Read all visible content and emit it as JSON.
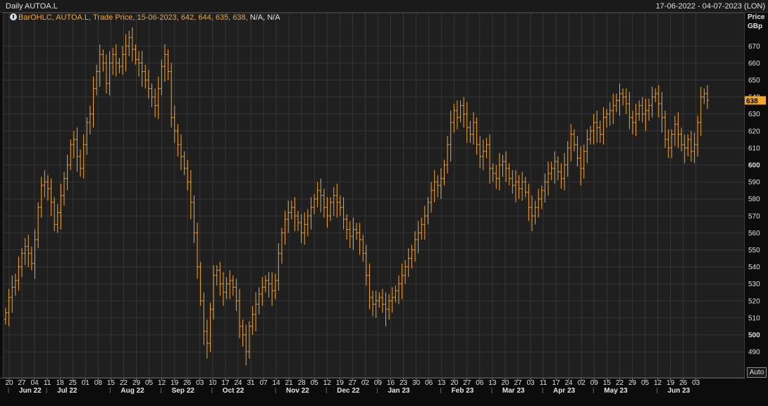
{
  "header": {
    "title": "Daily AUTOA.L",
    "date_range": "17-06-2022 - 04-07-2023 (LON)"
  },
  "legend": {
    "text": "BarOHLC, AUTOA.L, Trade Price,  15-06-2023, 642, 644, 635, 638,",
    "na": " N/A, N/A",
    "icon": "info-circle-icon"
  },
  "y_axis": {
    "title_line1": "Price",
    "title_line2": "GBp",
    "ticks": [
      490,
      500,
      510,
      520,
      530,
      540,
      550,
      560,
      570,
      580,
      590,
      600,
      610,
      620,
      630,
      640,
      650,
      660,
      670
    ],
    "bold_ticks": [
      500,
      600
    ],
    "last_value": "638"
  },
  "x_axis": {
    "day_ticks": [
      "20",
      "27",
      "04",
      "11",
      "18",
      "25",
      "01",
      "08",
      "15",
      "22",
      "29",
      "05",
      "12",
      "19",
      "26",
      "03",
      "10",
      "17",
      "24",
      "31",
      "07",
      "14",
      "21",
      "28",
      "05",
      "12",
      "19",
      "27",
      "02",
      "09",
      "16",
      "23",
      "30",
      "06",
      "13",
      "20",
      "27",
      "06",
      "13",
      "20",
      "27",
      "03",
      "11",
      "17",
      "24",
      "02",
      "09",
      "15",
      "22",
      "29",
      "05",
      "12",
      "19",
      "26",
      "03"
    ],
    "month_labels": [
      {
        "label": "Jun 22",
        "tick": 0
      },
      {
        "label": "Jul 22",
        "tick": 3
      },
      {
        "label": "Aug 22",
        "tick": 8
      },
      {
        "label": "Sep 22",
        "tick": 12
      },
      {
        "label": "Oct 22",
        "tick": 16
      },
      {
        "label": "Nov 22",
        "tick": 21
      },
      {
        "label": "Dec 22",
        "tick": 25
      },
      {
        "label": "Jan 23",
        "tick": 29
      },
      {
        "label": "Feb 23",
        "tick": 34
      },
      {
        "label": "Mar 23",
        "tick": 38
      },
      {
        "label": "Apr 23",
        "tick": 42
      },
      {
        "label": "May 23",
        "tick": 46
      },
      {
        "label": "Jun 23",
        "tick": 51
      }
    ]
  },
  "auto_button": "Auto",
  "colors": {
    "bar": "#f5a623",
    "grid": "#363636",
    "background": "#1f1f1f"
  },
  "chart_data": {
    "type": "ohlc",
    "title": "Daily AUTOA.L",
    "ylabel": "Price GBp",
    "ylim": [
      480,
      680
    ],
    "x_range": [
      "2022-06-17",
      "2023-07-04"
    ],
    "last_bar": {
      "date": "15-06-2023",
      "open": 642,
      "high": 644,
      "low": 635,
      "close": 638
    },
    "series": [
      {
        "name": "AUTOA.L",
        "points": [
          [
            0,
            513
          ],
          [
            1,
            522
          ],
          [
            2,
            528
          ],
          [
            3,
            532
          ],
          [
            4,
            540
          ],
          [
            5,
            548
          ],
          [
            6,
            552
          ],
          [
            7,
            548
          ],
          [
            8,
            542
          ],
          [
            9,
            556
          ],
          [
            10,
            575
          ],
          [
            11,
            588
          ],
          [
            12,
            590
          ],
          [
            13,
            586
          ],
          [
            14,
            578
          ],
          [
            15,
            565
          ],
          [
            16,
            572
          ],
          [
            17,
            582
          ],
          [
            18,
            592
          ],
          [
            19,
            600
          ],
          [
            20,
            612
          ],
          [
            21,
            615
          ],
          [
            22,
            605
          ],
          [
            23,
            598
          ],
          [
            24,
            612
          ],
          [
            25,
            625
          ],
          [
            26,
            630
          ],
          [
            27,
            645
          ],
          [
            28,
            655
          ],
          [
            29,
            665
          ],
          [
            30,
            660
          ],
          [
            31,
            648
          ],
          [
            32,
            660
          ],
          [
            33,
            665
          ],
          [
            34,
            660
          ],
          [
            35,
            658
          ],
          [
            36,
            665
          ],
          [
            37,
            670
          ],
          [
            38,
            675
          ],
          [
            39,
            668
          ],
          [
            40,
            662
          ],
          [
            41,
            660
          ],
          [
            42,
            655
          ],
          [
            43,
            650
          ],
          [
            44,
            645
          ],
          [
            45,
            640
          ],
          [
            46,
            635
          ],
          [
            47,
            645
          ],
          [
            48,
            658
          ],
          [
            49,
            665
          ],
          [
            50,
            655
          ],
          [
            51,
            628
          ],
          [
            52,
            620
          ],
          [
            53,
            612
          ],
          [
            54,
            605
          ],
          [
            55,
            598
          ],
          [
            56,
            590
          ],
          [
            57,
            578
          ],
          [
            58,
            560
          ],
          [
            59,
            540
          ],
          [
            60,
            520
          ],
          [
            61,
            502
          ],
          [
            62,
            495
          ],
          [
            63,
            515
          ],
          [
            64,
            535
          ],
          [
            65,
            538
          ],
          [
            66,
            530
          ],
          [
            67,
            525
          ],
          [
            68,
            530
          ],
          [
            69,
            532
          ],
          [
            70,
            528
          ],
          [
            71,
            520
          ],
          [
            72,
            505
          ],
          [
            73,
            500
          ],
          [
            74,
            490
          ],
          [
            75,
            505
          ],
          [
            76,
            512
          ],
          [
            77,
            518
          ],
          [
            78,
            524
          ],
          [
            79,
            528
          ],
          [
            80,
            532
          ],
          [
            81,
            530
          ],
          [
            82,
            526
          ],
          [
            83,
            532
          ],
          [
            84,
            548
          ],
          [
            85,
            560
          ],
          [
            86,
            568
          ],
          [
            87,
            572
          ],
          [
            88,
            575
          ],
          [
            89,
            570
          ],
          [
            90,
            566
          ],
          [
            91,
            560
          ],
          [
            92,
            565
          ],
          [
            93,
            570
          ],
          [
            94,
            575
          ],
          [
            95,
            580
          ],
          [
            96,
            585
          ],
          [
            97,
            582
          ],
          [
            98,
            575
          ],
          [
            99,
            570
          ],
          [
            100,
            578
          ],
          [
            101,
            582
          ],
          [
            102,
            578
          ],
          [
            103,
            575
          ],
          [
            104,
            568
          ],
          [
            105,
            562
          ],
          [
            106,
            558
          ],
          [
            107,
            562
          ],
          [
            108,
            560
          ],
          [
            109,
            556
          ],
          [
            110,
            548
          ],
          [
            111,
            535
          ],
          [
            112,
            522
          ],
          [
            113,
            518
          ],
          [
            114,
            520
          ],
          [
            115,
            522
          ],
          [
            116,
            518
          ],
          [
            117,
            515
          ],
          [
            118,
            520
          ],
          [
            119,
            522
          ],
          [
            120,
            526
          ],
          [
            121,
            530
          ],
          [
            122,
            535
          ],
          [
            123,
            540
          ],
          [
            124,
            545
          ],
          [
            125,
            550
          ],
          [
            126,
            556
          ],
          [
            127,
            560
          ],
          [
            128,
            565
          ],
          [
            129,
            570
          ],
          [
            130,
            578
          ],
          [
            131,
            585
          ],
          [
            132,
            590
          ],
          [
            133,
            588
          ],
          [
            134,
            592
          ],
          [
            135,
            600
          ],
          [
            136,
            612
          ],
          [
            137,
            625
          ],
          [
            138,
            632
          ],
          [
            139,
            628
          ],
          [
            140,
            635
          ],
          [
            141,
            630
          ],
          [
            142,
            622
          ],
          [
            143,
            618
          ],
          [
            144,
            625
          ],
          [
            145,
            612
          ],
          [
            146,
            605
          ],
          [
            147,
            608
          ],
          [
            148,
            612
          ],
          [
            149,
            598
          ],
          [
            150,
            595
          ],
          [
            151,
            592
          ],
          [
            152,
            600
          ],
          [
            153,
            602
          ],
          [
            154,
            598
          ],
          [
            155,
            592
          ],
          [
            156,
            588
          ],
          [
            157,
            590
          ],
          [
            158,
            586
          ],
          [
            159,
            590
          ],
          [
            160,
            584
          ],
          [
            161,
            575
          ],
          [
            162,
            570
          ],
          [
            163,
            575
          ],
          [
            164,
            580
          ],
          [
            165,
            585
          ],
          [
            166,
            590
          ],
          [
            167,
            595
          ],
          [
            168,
            598
          ],
          [
            169,
            602
          ],
          [
            170,
            596
          ],
          [
            171,
            592
          ],
          [
            172,
            600
          ],
          [
            173,
            610
          ],
          [
            174,
            618
          ],
          [
            175,
            612
          ],
          [
            176,
            604
          ],
          [
            177,
            598
          ],
          [
            178,
            608
          ],
          [
            179,
            615
          ],
          [
            180,
            620
          ],
          [
            181,
            625
          ],
          [
            182,
            622
          ],
          [
            183,
            618
          ],
          [
            184,
            628
          ],
          [
            185,
            630
          ],
          [
            186,
            632
          ],
          [
            187,
            635
          ],
          [
            188,
            638
          ],
          [
            189,
            642
          ],
          [
            190,
            640
          ],
          [
            191,
            636
          ],
          [
            192,
            628
          ],
          [
            193,
            625
          ],
          [
            194,
            630
          ],
          [
            195,
            635
          ],
          [
            196,
            630
          ],
          [
            197,
            632
          ],
          [
            198,
            635
          ],
          [
            199,
            640
          ],
          [
            200,
            642
          ],
          [
            201,
            636
          ],
          [
            202,
            628
          ],
          [
            203,
            615
          ],
          [
            204,
            610
          ],
          [
            205,
            618
          ],
          [
            206,
            624
          ],
          [
            207,
            618
          ],
          [
            208,
            612
          ],
          [
            209,
            610
          ],
          [
            210,
            615
          ],
          [
            211,
            608
          ],
          [
            212,
            612
          ],
          [
            213,
            625
          ],
          [
            214,
            640
          ],
          [
            215,
            642
          ],
          [
            216,
            638
          ]
        ]
      }
    ]
  }
}
